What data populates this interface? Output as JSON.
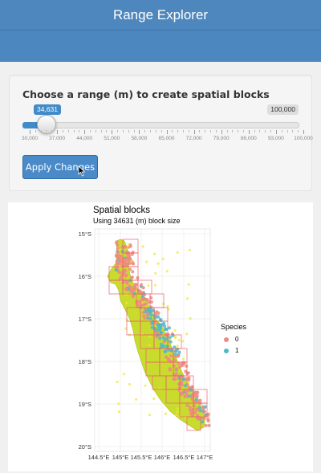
{
  "navbar": {
    "title": "Range Explorer"
  },
  "controls": {
    "label": "Choose a range (m) to create spatial blocks",
    "slider": {
      "value_label": "34,631",
      "max_label": "100,000",
      "tick_labels": [
        "30,000",
        "37,000",
        "44,000",
        "51,000",
        "58,000",
        "65,000",
        "72,000",
        "79,000",
        "86,000",
        "93,000",
        "100,000"
      ]
    },
    "apply_button": "Apply Changes"
  },
  "plot": {
    "title": "Spatial blocks",
    "subtitle": "Using 34631 (m) block size",
    "y_ticks": [
      "15°S",
      "16°S",
      "17°S",
      "18°S",
      "19°S",
      "20°S"
    ],
    "x_ticks": [
      "144.5°E",
      "145°E",
      "145.5°E",
      "146°E",
      "146.5°E",
      "147°E"
    ],
    "legend": {
      "title": "Species",
      "items": [
        {
          "label": "0",
          "color": "#f08a80"
        },
        {
          "label": "1",
          "color": "#4fbac6"
        }
      ]
    },
    "colors": {
      "land": "#c9dc2e",
      "species0": "#f08a80",
      "species1": "#4fbac6",
      "block": "#e8636a"
    }
  }
}
